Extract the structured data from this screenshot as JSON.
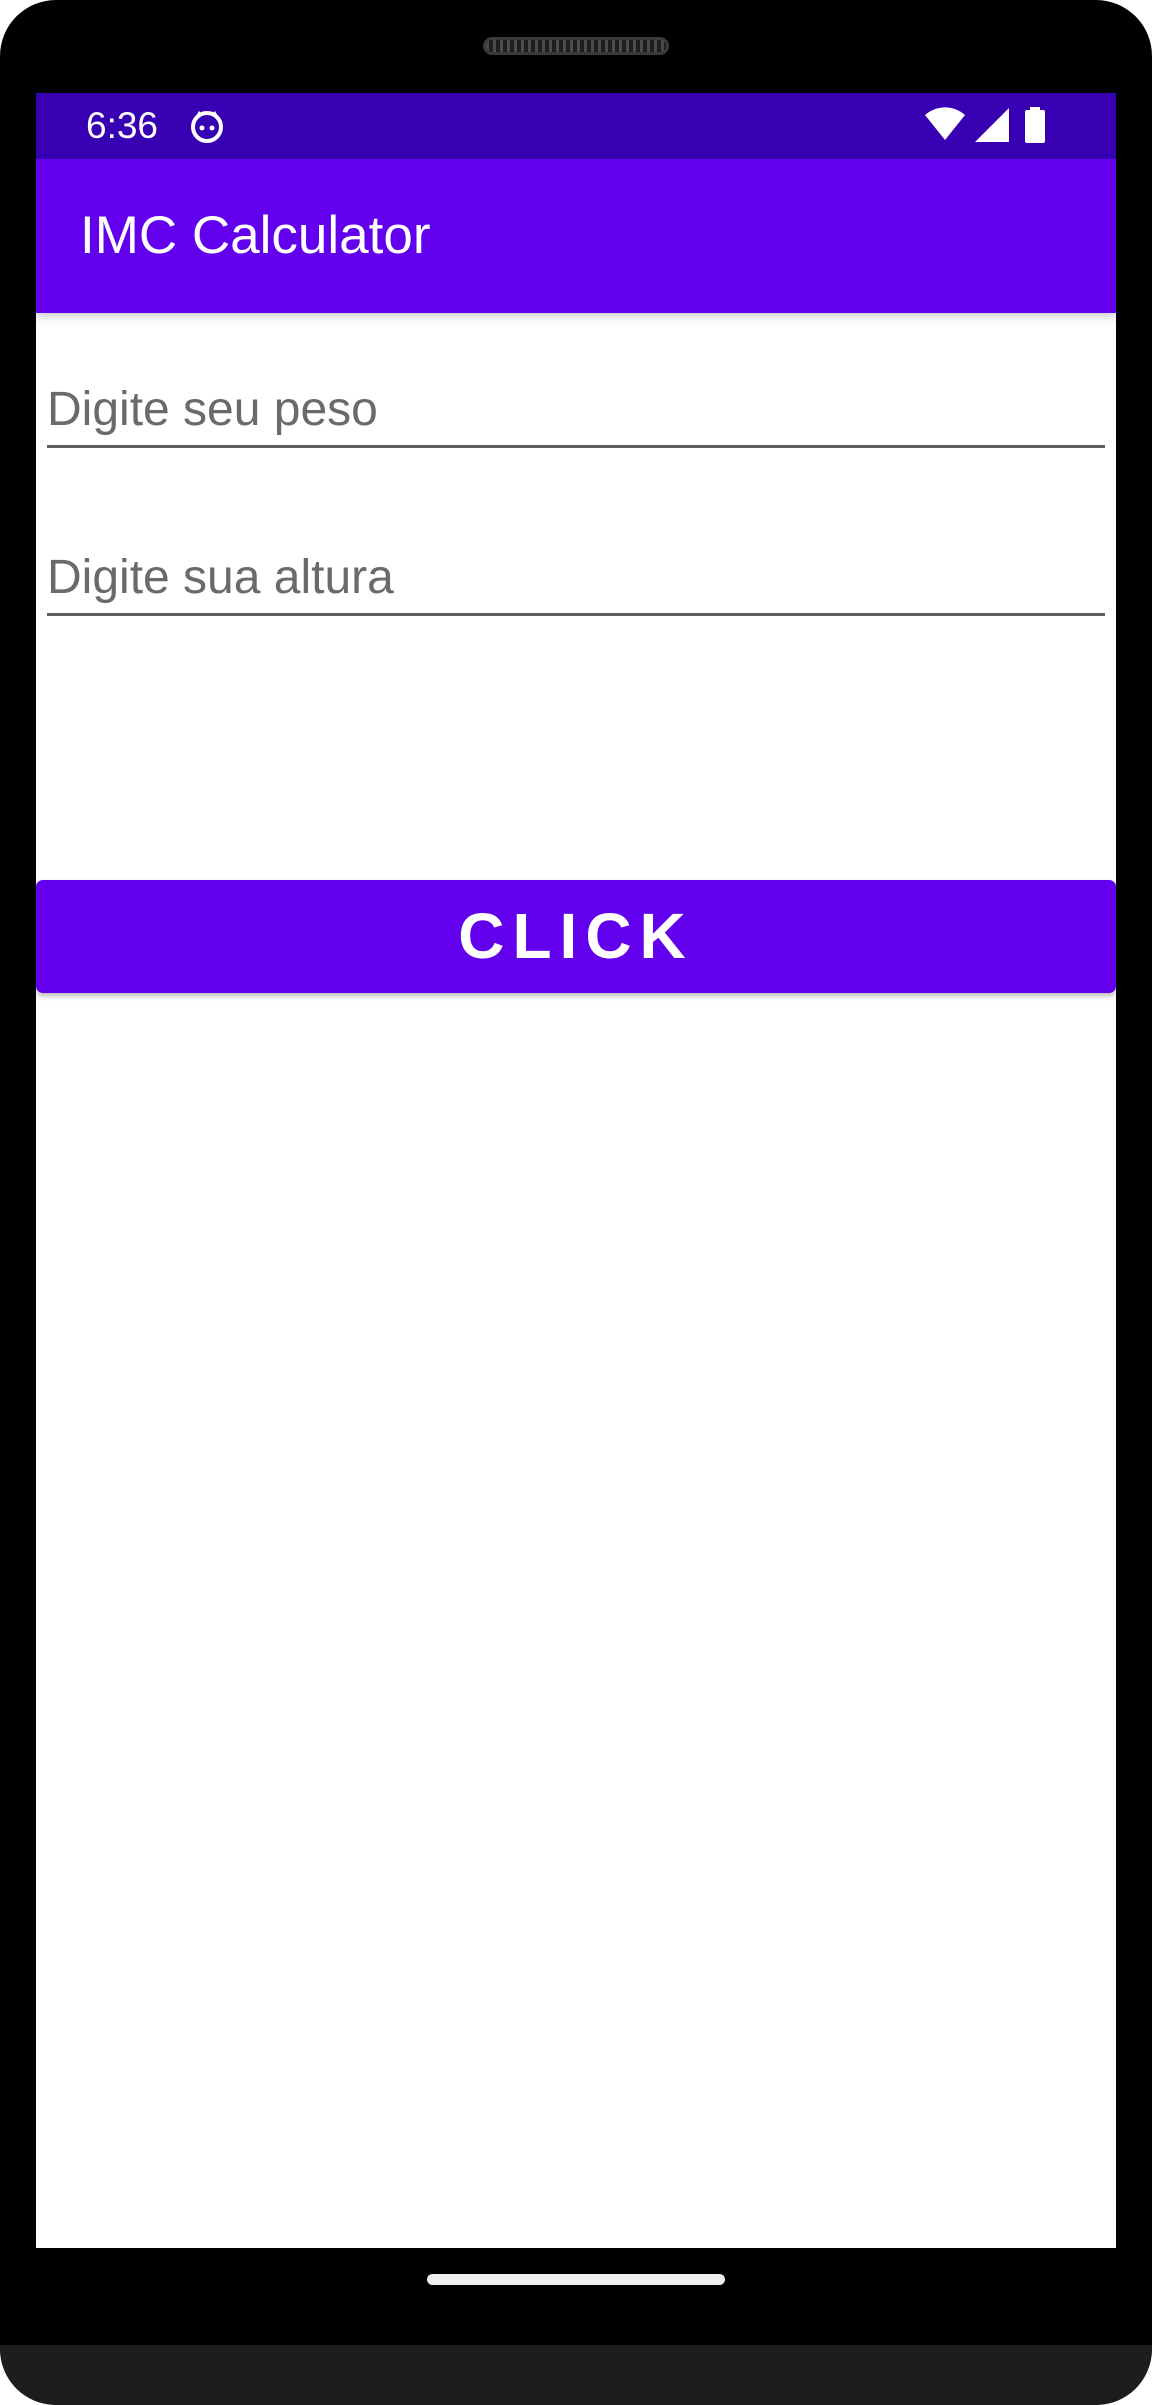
{
  "status_bar": {
    "time": "6:36",
    "icons": [
      "notification-cat-icon",
      "wifi-icon",
      "signal-icon",
      "battery-icon"
    ]
  },
  "app_bar": {
    "title": "IMC Calculator"
  },
  "form": {
    "weight_value": "",
    "weight_placeholder": "Digite seu peso",
    "height_value": "",
    "height_placeholder": "Digite sua altura",
    "button_label": "CLICK"
  },
  "colors": {
    "status_bar": "#3700b3",
    "primary": "#6200ee",
    "on_primary": "#ffffff",
    "hint_text": "#6a6a6a"
  }
}
